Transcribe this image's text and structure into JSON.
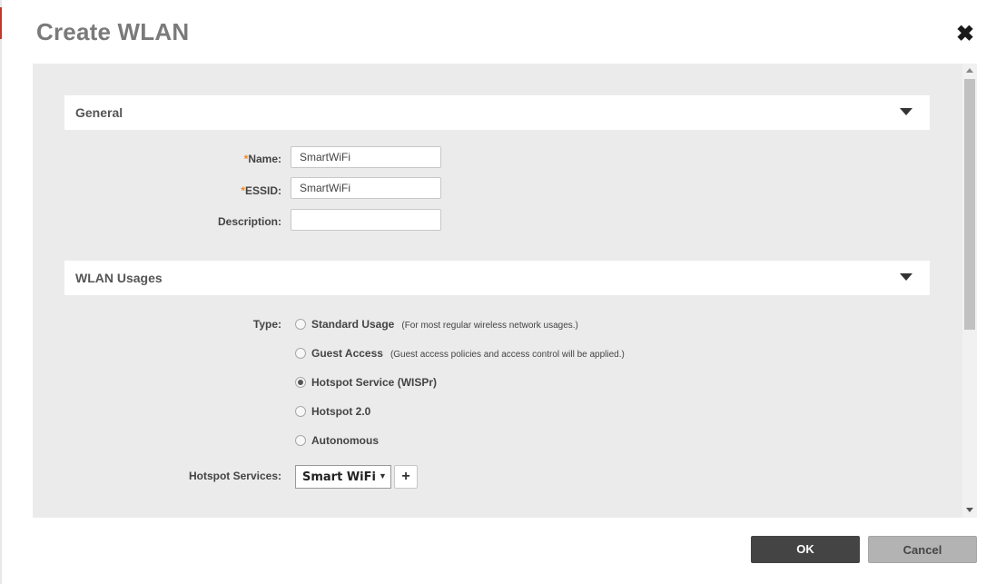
{
  "dialog": {
    "title": "Create WLAN",
    "close_icon": "close-icon"
  },
  "sections": {
    "general": {
      "label": "General",
      "toggle_icon": "caret-down-icon",
      "fields": {
        "name": {
          "required_mark": "*",
          "label": "Name:",
          "value": "SmartWiFi"
        },
        "essid": {
          "required_mark": "*",
          "label": "ESSID:",
          "value": "SmartWiFi"
        },
        "description": {
          "label": "Description:",
          "value": ""
        }
      }
    },
    "wlan_usages": {
      "label": "WLAN Usages",
      "toggle_icon": "caret-down-icon",
      "type_label": "Type:",
      "types": [
        {
          "label": "Standard Usage",
          "hint": "(For most regular wireless network usages.)",
          "checked": false
        },
        {
          "label": "Guest Access",
          "hint": "(Guest access policies and access control will be applied.)",
          "checked": false
        },
        {
          "label": "Hotspot Service (WISPr)",
          "hint": "",
          "checked": true
        },
        {
          "label": "Hotspot 2.0",
          "hint": "",
          "checked": false
        },
        {
          "label": "Autonomous",
          "hint": "",
          "checked": false
        }
      ],
      "hotspot_services": {
        "label": "Hotspot Services:",
        "selected": "Smart WiFi",
        "dropdown_icon": "dropdown-arrow-icon",
        "add_label": "+"
      }
    }
  },
  "footer": {
    "ok_label": "OK",
    "cancel_label": "Cancel"
  },
  "colors": {
    "required": "#f08a24",
    "ok_button": "#444444",
    "cancel_button": "#b3b3b3",
    "content_background": "#ebebeb"
  }
}
